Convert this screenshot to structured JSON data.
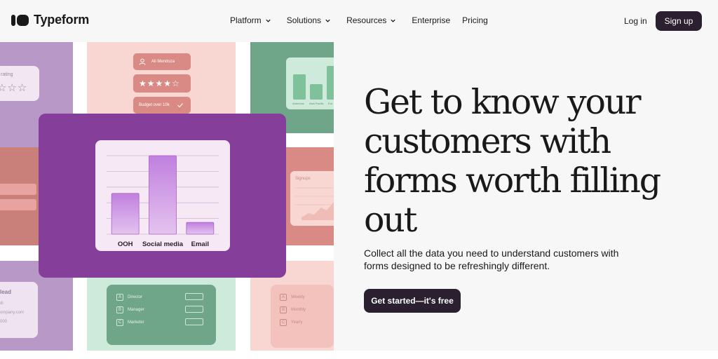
{
  "brand": {
    "name": "Typeform"
  },
  "nav": {
    "items": [
      {
        "label": "Platform",
        "has_dropdown": true
      },
      {
        "label": "Solutions",
        "has_dropdown": true
      },
      {
        "label": "Resources",
        "has_dropdown": true
      },
      {
        "label": "Enterprise",
        "has_dropdown": false
      },
      {
        "label": "Pricing",
        "has_dropdown": false
      }
    ],
    "login_label": "Log in",
    "signup_label": "Sign up"
  },
  "hero": {
    "headline": "Get to know your customers with forms worth filling out",
    "subheadline": "Collect all the data you need to understand customers with forms designed to be refreshingly different.",
    "cta_label": "Get started—it's free"
  },
  "collage": {
    "rating_label": "rating",
    "name_field": "Ali Mendoza",
    "budget_label": "Budget over 10k",
    "signups_label": "Signups",
    "lead_label": "lead",
    "email_fragment": "ompany.com",
    "phone_fragment": "000",
    "d_fragment": "di",
    "region_labels": [
      "Americas",
      "Asia Pacific",
      "Eur"
    ],
    "role_options": [
      {
        "key": "A",
        "label": "Director"
      },
      {
        "key": "B",
        "label": "Manager"
      },
      {
        "key": "C",
        "label": "Marketer"
      }
    ],
    "frequency_options": [
      {
        "key": "A",
        "label": "Weekly"
      },
      {
        "key": "B",
        "label": "Monthly"
      },
      {
        "key": "C",
        "label": "Yearly"
      }
    ]
  },
  "chart_data": {
    "type": "bar",
    "categories": [
      "OOH",
      "Social media",
      "Email"
    ],
    "values": [
      52,
      100,
      15
    ],
    "ylim": [
      0,
      100
    ],
    "grid": true,
    "bar_color": "#c080df"
  },
  "colors": {
    "dark_button": "#2b2030",
    "purple_panel": "#853f9b",
    "background": "#f8f7f8"
  }
}
